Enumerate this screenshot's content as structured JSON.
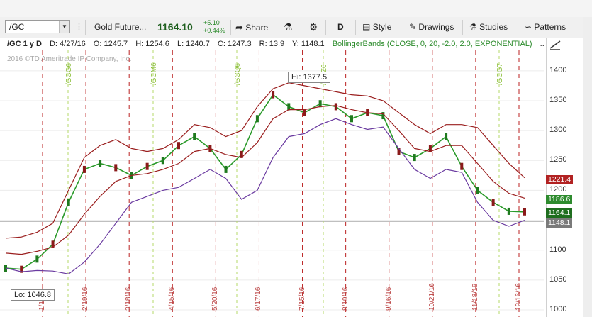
{
  "toolbar": {
    "symbol": "/GC",
    "name": "Gold Future...",
    "price": "1164.10",
    "change": "+5.10",
    "change_pct": "+0.44%",
    "share": "Share",
    "period": "D",
    "style": "Style",
    "drawings": "Drawings",
    "studies": "Studies",
    "patterns": "Patterns"
  },
  "info": {
    "label": "/GC 1 y D",
    "date": "D: 4/27/16",
    "open": "O: 1245.7",
    "high": "H: 1254.6",
    "low": "L: 1240.7",
    "close": "C: 1247.3",
    "range": "R: 13.9",
    "y": "Y: 1148.1",
    "study": "BollingerBands (CLOSE, 0, 20, -2.0, 2.0, EXPONENTIAL)",
    "more": ".."
  },
  "copyright": "2016 ©TD Ameritrade IP Company, Inc.",
  "callouts": {
    "hi": "Hi: 1377.5",
    "lo": "Lo: 1046.8"
  },
  "price_tags": {
    "upper": {
      "text": "1221.4",
      "color": "#b22222"
    },
    "middle": {
      "text": "1186.6",
      "color": "#2e8b2e"
    },
    "last": {
      "text": "1164.1",
      "color": "#1f6e1f"
    },
    "cursor": {
      "text": "1148.1",
      "color": "#7a7a7a"
    }
  },
  "expirations": [
    "/GCG6",
    "/GCM6",
    "/GCQ6",
    "/GCZ6",
    "/GCG7"
  ],
  "chart_data": {
    "type": "line",
    "ylim": [
      1000,
      1420
    ],
    "yticks": [
      1000,
      1050,
      1100,
      1150,
      1200,
      1250,
      1300,
      1350,
      1400
    ],
    "xticks": [
      "1/16",
      "2/19/16",
      "3/18/16",
      "4/15/16",
      "5/20/16",
      "6/17/16",
      "7/15/16",
      "8/19/16",
      "9/16/16",
      "10/21/16",
      "11/18/16",
      "12/16/16"
    ],
    "series": [
      {
        "values": [
          1070,
          1068,
          1085,
          1110,
          1180,
          1235,
          1245,
          1238,
          1225,
          1240,
          1250,
          1275,
          1290,
          1270,
          1235,
          1260,
          1320,
          1360,
          1340,
          1330,
          1345,
          1340,
          1320,
          1330,
          1325,
          1265,
          1255,
          1270,
          1290,
          1240,
          1200,
          1180,
          1165,
          1164
        ]
      },
      {
        "values": [
          1095,
          1093,
          1098,
          1105,
          1125,
          1160,
          1190,
          1215,
          1225,
          1228,
          1235,
          1245,
          1265,
          1270,
          1260,
          1255,
          1280,
          1320,
          1335,
          1335,
          1340,
          1342,
          1335,
          1330,
          1328,
          1300,
          1270,
          1265,
          1275,
          1275,
          1245,
          1215,
          1195,
          1187
        ]
      },
      {
        "values": [
          1120,
          1122,
          1130,
          1145,
          1200,
          1255,
          1275,
          1285,
          1270,
          1265,
          1270,
          1285,
          1310,
          1305,
          1290,
          1300,
          1340,
          1370,
          1380,
          1375,
          1370,
          1365,
          1360,
          1358,
          1350,
          1330,
          1310,
          1295,
          1310,
          1310,
          1305,
          1275,
          1245,
          1221
        ]
      },
      {
        "values": [
          1070,
          1064,
          1066,
          1065,
          1060,
          1080,
          1110,
          1145,
          1180,
          1190,
          1200,
          1205,
          1220,
          1235,
          1220,
          1185,
          1200,
          1255,
          1290,
          1295,
          1310,
          1320,
          1310,
          1302,
          1306,
          1270,
          1235,
          1220,
          1235,
          1230,
          1180,
          1150,
          1140,
          1150
        ]
      }
    ]
  }
}
